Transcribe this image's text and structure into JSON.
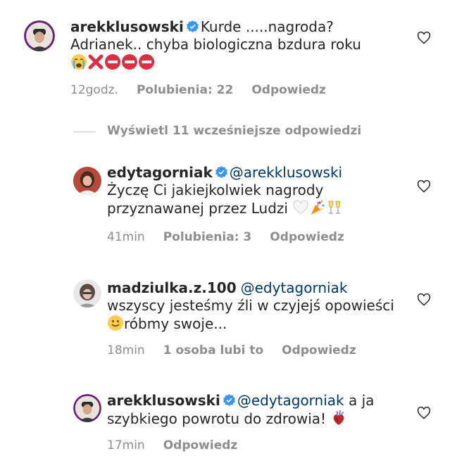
{
  "comments": [
    {
      "username": "arekklusowski",
      "verified": true,
      "mention": "",
      "text": "Kurde .....nagroda? Adrianek.. chyba biologiczna bzdura roku",
      "time": "12godz.",
      "likes": "Polubienia: 22",
      "reply": "Odpowiedz",
      "emojis": [
        "crying-face",
        "cross-mark",
        "no-entry",
        "no-entry",
        "no-entry"
      ]
    },
    {
      "username": "edytagorniak",
      "verified": true,
      "mention": "@arekklusowski",
      "text": "Życzę Ci jakiejkolwiek nagrody przyznawanej przez Ludzi",
      "time": "41min",
      "likes": "Polubienia: 3",
      "reply": "Odpowiedz",
      "emojis": [
        "white-heart",
        "party-popper",
        "clinking-glasses"
      ]
    },
    {
      "username": "madziulka.z.100",
      "verified": false,
      "mention": "@edytagorniak",
      "text_a": "wszyscy jesteśmy źli w czyjejś opowieści",
      "text_b": "róbmy swoje...",
      "time": "18min",
      "likes": "1 osoba lubi to",
      "reply": "Odpowiedz",
      "emojis": [
        "slightly-smiling-face"
      ]
    },
    {
      "username": "arekklusowski",
      "verified": true,
      "mention": "@edytagorniak",
      "text": "a ja szybkiego powrotu do zdrowia!",
      "time": "17min",
      "likes": "",
      "reply": "Odpowiedz",
      "emojis": [
        "anatomical-heart"
      ]
    }
  ],
  "view_replies": {
    "label": "Wyświetl 11 wcześniejsze odpowiedzi"
  },
  "colors": {
    "text": "#262626",
    "secondary": "#8e8e8e",
    "mention": "#00376b",
    "verified": "#3897f0"
  },
  "icons": {
    "like": "heart-outline-icon",
    "verified": "verified-badge-icon"
  }
}
